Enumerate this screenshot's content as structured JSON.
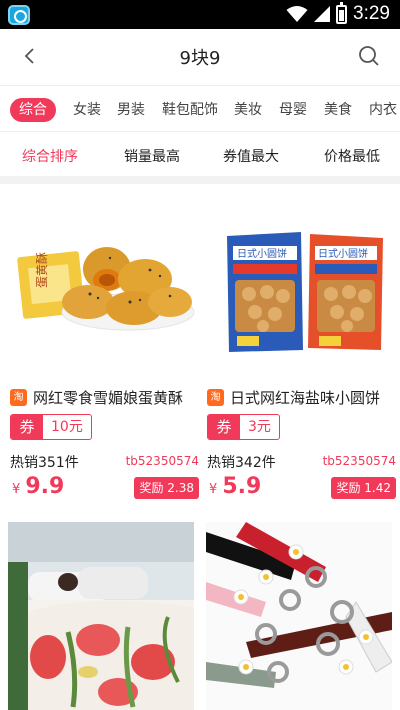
{
  "status_bar": {
    "time": "3:29",
    "app_icon": "app-icon",
    "wifi_icon": "wifi-icon",
    "battery_icon": "battery-icon"
  },
  "nav": {
    "title": "9块9",
    "back_icon": "back-arrow-icon",
    "search_icon": "search-icon"
  },
  "categories": [
    {
      "label": "综合",
      "active": true
    },
    {
      "label": "女装",
      "active": false
    },
    {
      "label": "男装",
      "active": false
    },
    {
      "label": "鞋包配饰",
      "active": false
    },
    {
      "label": "美妆",
      "active": false
    },
    {
      "label": "母婴",
      "active": false
    },
    {
      "label": "美食",
      "active": false
    },
    {
      "label": "内衣",
      "active": false
    }
  ],
  "sorts": [
    {
      "label": "综合排序",
      "active": true
    },
    {
      "label": "销量最高",
      "active": false
    },
    {
      "label": "券值最大",
      "active": false
    },
    {
      "label": "价格最低",
      "active": false
    }
  ],
  "products": [
    {
      "platform_icon": "淘",
      "title": "网红零食雪媚娘蛋黄酥",
      "coupon_label": "券",
      "coupon_value": "10元",
      "sold": "热销351件",
      "seller": "tb52350574",
      "price_symbol": "¥",
      "price": "9.9",
      "reward": "奖励 2.38"
    },
    {
      "platform_icon": "淘",
      "title": "日式网红海盐味小圆饼",
      "coupon_label": "券",
      "coupon_value": "3元",
      "sold": "热销342件",
      "seller": "tb52350574",
      "price_symbol": "¥",
      "price": "5.9",
      "reward": "奖励 1.42"
    }
  ],
  "colors": {
    "accent": "#f1395a",
    "platform": "#ff6a1f"
  }
}
